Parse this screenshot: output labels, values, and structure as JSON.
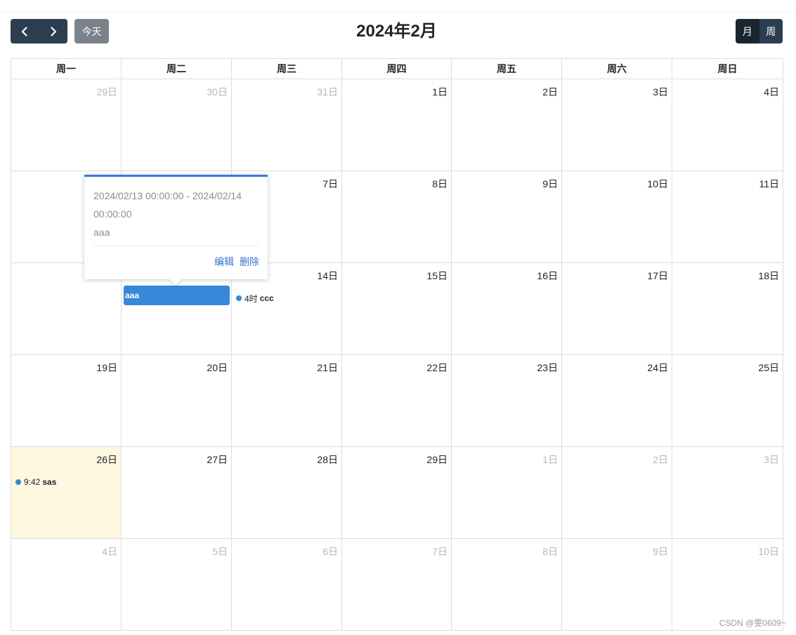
{
  "toolbar": {
    "prev_icon": "chevron-left-icon",
    "next_icon": "chevron-right-icon",
    "today_label": "今天",
    "title": "2024年2月",
    "views": [
      {
        "label": "月",
        "active": true
      },
      {
        "label": "周",
        "active": false
      }
    ]
  },
  "calendar": {
    "weekdays": [
      "周一",
      "周二",
      "周三",
      "周四",
      "周五",
      "周六",
      "周日"
    ],
    "weeks": [
      [
        {
          "label": "29日",
          "other": true
        },
        {
          "label": "30日",
          "other": true
        },
        {
          "label": "31日",
          "other": true
        },
        {
          "label": "1日"
        },
        {
          "label": "2日"
        },
        {
          "label": "3日"
        },
        {
          "label": "4日"
        }
      ],
      [
        {
          "label": ""
        },
        {
          "label": ""
        },
        {
          "label": "7日"
        },
        {
          "label": "8日"
        },
        {
          "label": "9日"
        },
        {
          "label": "10日"
        },
        {
          "label": "11日"
        }
      ],
      [
        {
          "label": ""
        },
        {
          "label": ""
        },
        {
          "label": "14日"
        },
        {
          "label": "15日"
        },
        {
          "label": "16日"
        },
        {
          "label": "17日"
        },
        {
          "label": "18日"
        }
      ],
      [
        {
          "label": "19日"
        },
        {
          "label": "20日"
        },
        {
          "label": "21日"
        },
        {
          "label": "22日"
        },
        {
          "label": "23日"
        },
        {
          "label": "24日"
        },
        {
          "label": "25日"
        }
      ],
      [
        {
          "label": "26日",
          "today": true
        },
        {
          "label": "27日"
        },
        {
          "label": "28日"
        },
        {
          "label": "29日"
        },
        {
          "label": "1日",
          "other": true
        },
        {
          "label": "2日",
          "other": true
        },
        {
          "label": "3日",
          "other": true
        }
      ],
      [
        {
          "label": "4日",
          "other": true
        },
        {
          "label": "5日",
          "other": true
        },
        {
          "label": "6日",
          "other": true
        },
        {
          "label": "7日",
          "other": true
        },
        {
          "label": "8日",
          "other": true
        },
        {
          "label": "9日",
          "other": true
        },
        {
          "label": "10日",
          "other": true
        }
      ]
    ],
    "events": {
      "aaa": {
        "title": "aaa",
        "color": "#3788d8"
      },
      "ccc": {
        "time": "4时",
        "title": "ccc",
        "color": "#3788d8"
      },
      "sas": {
        "time": "9:42",
        "title": "sas",
        "color": "#3788d8"
      }
    }
  },
  "popover": {
    "range": "2024/02/13 00:00:00 - 2024/02/14 00:00:00",
    "title": "aaa",
    "edit_label": "编辑",
    "delete_label": "删除",
    "accent_color": "#3a76e0"
  },
  "watermark": "CSDN @雯0609~"
}
